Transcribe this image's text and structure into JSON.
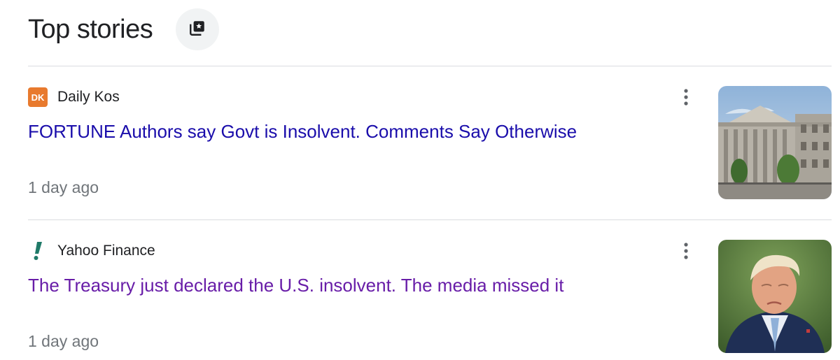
{
  "header": {
    "title": "Top stories",
    "feed_icon": "stacked-cards-star-icon"
  },
  "stories": [
    {
      "source": "Daily Kos",
      "source_logo_text": "DK",
      "source_logo_color": "#e87a2e",
      "headline": "FORTUNE Authors say Govt is Insolvent. Comments Say Otherwise",
      "headline_color": "#1a0dab",
      "time": "1 day ago",
      "thumbnail": "government-building-photo"
    },
    {
      "source": "Yahoo Finance",
      "source_logo_icon": "exclamation-mark-icon",
      "source_logo_color": "#1f7a68",
      "headline": "The Treasury just declared the U.S. insolvent. The media missed it",
      "headline_color": "#681da8",
      "time": "1 day ago",
      "thumbnail": "man-portrait-photo"
    }
  ],
  "colors": {
    "title": "#202124",
    "meta": "#70757a",
    "divider": "#dadce0"
  }
}
